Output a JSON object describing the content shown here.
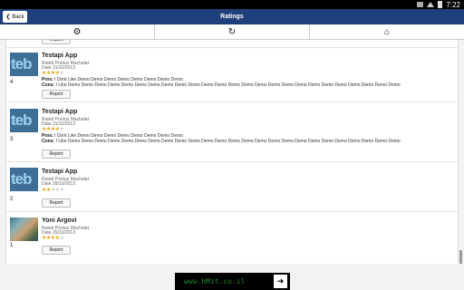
{
  "status_bar": {
    "time": "7:22"
  },
  "title_bar": {
    "back_label": "Back",
    "back_arrow": "❮",
    "title": "Ratings"
  },
  "toolbar": {
    "items": [
      {
        "icon": "gear-icon",
        "glyph": "⚙"
      },
      {
        "icon": "refresh-icon",
        "glyph": "↻"
      },
      {
        "icon": "home-icon",
        "glyph": "⌂"
      }
    ]
  },
  "report_label": "Report",
  "ratings": [
    {
      "rank": "4",
      "name": "Testapi App",
      "thumb_text": "teb",
      "rated_by": "Rated Pontus Machalat",
      "date": "Date 31/10/2013",
      "stars": 4,
      "pros_label": "Pros:",
      "pros": "I Dont Like Demo Demo Demo Demo Demo Demo Demo Demo",
      "cons_label": "Cons:",
      "cons": "I Like Demo Demo Demo Demo Demo Demo Demo Demo Demo Demo Demo Demo Demo Demo Demo Demo Demo Demo Demo Demo Demo Demo Demo Demo Demo"
    },
    {
      "rank": "3",
      "name": "Testapi App",
      "thumb_text": "teb",
      "rated_by": "Rated Pontus Machalat",
      "date": "Date 31/10/2013",
      "stars": 4,
      "pros_label": "Pros:",
      "pros": "I Dont Like Demo Demo Demo Demo Demo Demo Demo Demo",
      "cons_label": "Cons:",
      "cons": "I Like Demo Demo Demo Demo Demo Demo Demo Demo Demo Demo Demo Demo Demo Demo Demo Demo Demo Demo Demo Demo Demo Demo Demo Demo Demo"
    },
    {
      "rank": "2",
      "name": "Testapi App",
      "thumb_text": "teb",
      "rated_by": "Rated Pontus Machalat",
      "date": "Date 28/10/2013",
      "stars": 2
    },
    {
      "rank": "1",
      "name": "Yoni Argovi",
      "thumb_text": "",
      "rated_by": "Rated Pontus Machalat",
      "date": "Date 25/10/2013",
      "stars": 4
    }
  ],
  "ad": {
    "text": "www.hMit.co.il",
    "arrow": "➜"
  },
  "colors": {
    "title_bar": "#1f3f7a",
    "star_on": "#e3a21a",
    "star_off": "#cfcfcf"
  }
}
